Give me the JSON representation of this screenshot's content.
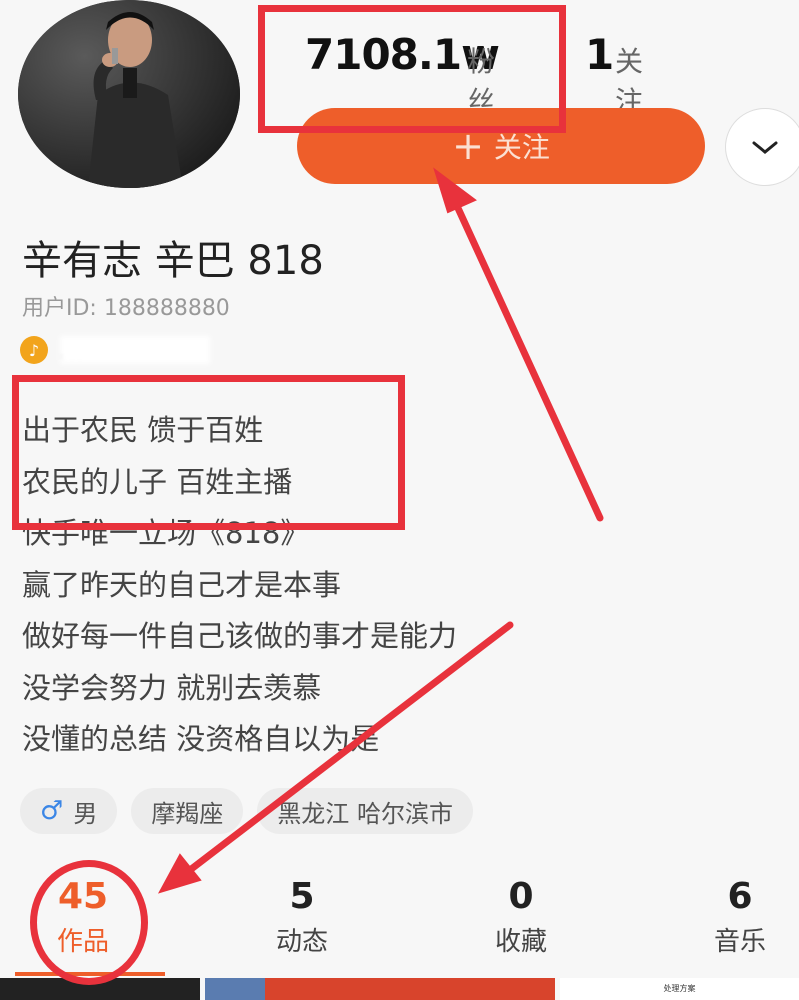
{
  "profile": {
    "followers_count": "7108.1w",
    "followers_label": "粉丝",
    "following_count": "1",
    "following_label": "关注",
    "follow_button_label": "关注",
    "name": "辛有志 辛巴 818",
    "user_id": "用户ID: 188888880",
    "music_line": "…"
  },
  "bio": [
    "出于农民 馈于百姓",
    "农民的儿子  百姓主播",
    "快手唯一立场《818》",
    "赢了昨天的自己才是本事",
    "做好每一件自己该做的事才是能力",
    "没学会努力 就别去羡慕",
    "没懂的总结 没资格自以为是"
  ],
  "tags": {
    "gender": "男",
    "zodiac": "摩羯座",
    "location": "黑龙江 哈尔滨市"
  },
  "tabs": [
    {
      "count": "45",
      "label": "作品"
    },
    {
      "count": "5",
      "label": "动态"
    },
    {
      "count": "0",
      "label": "收藏"
    },
    {
      "count": "6",
      "label": "音乐"
    }
  ],
  "thumb_caption": "处理方案",
  "colors": {
    "accent": "#ee5e2a",
    "annotation": "#e8323c",
    "background": "#f7f7f7"
  },
  "icons": [
    "male-icon",
    "music-note-icon",
    "chevron-down-icon",
    "plus-icon"
  ]
}
